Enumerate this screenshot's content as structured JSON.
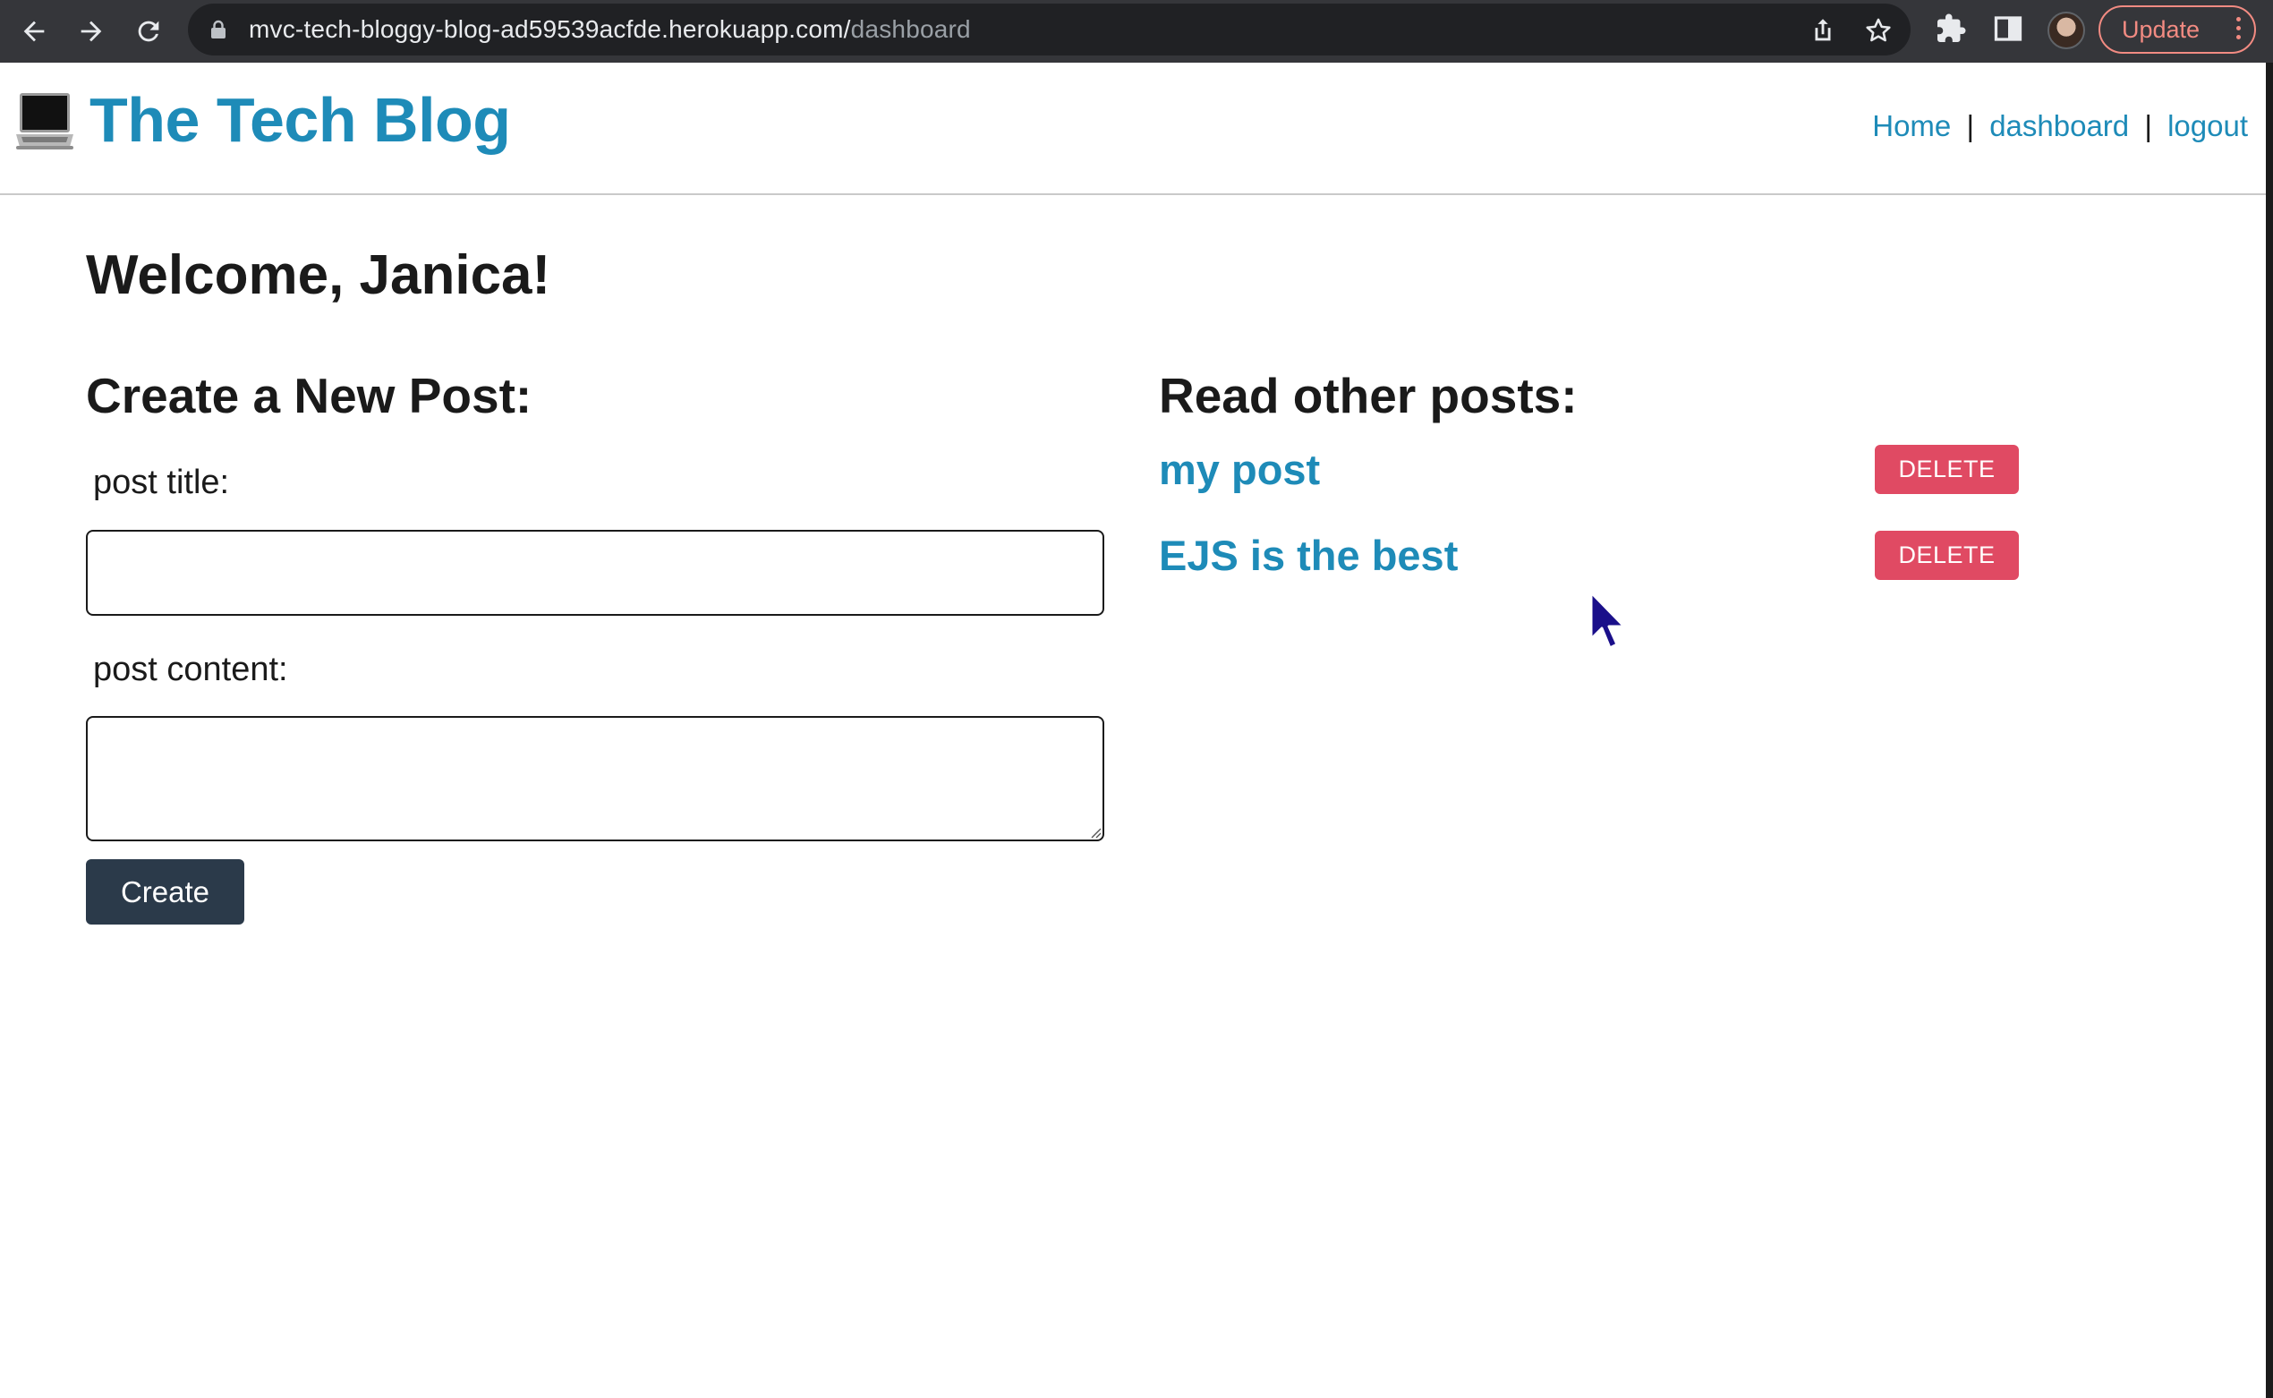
{
  "browser": {
    "url_host": "mvc-tech-bloggy-blog-ad59539acfde.herokuapp.com/",
    "url_path": "dashboard",
    "update_label": "Update",
    "colors": {
      "chrome_bg": "#35363a",
      "omnibox_bg": "#202124",
      "update_accent": "#f28b82"
    },
    "icons": [
      "back-arrow-icon",
      "forward-arrow-icon",
      "reload-icon",
      "lock-icon",
      "share-icon",
      "star-icon",
      "puzzle-icon",
      "side-panel-icon",
      "profile-avatar",
      "more-vert-icon"
    ]
  },
  "site": {
    "title": "The Tech Blog",
    "logo_icon": "laptop-icon",
    "nav": {
      "home": "Home",
      "separator": "|",
      "dashboard": "dashboard",
      "logout": "logout"
    },
    "colors": {
      "brand": "#1e8bb8",
      "text": "#1a1a1a"
    }
  },
  "dashboard": {
    "welcome": "Welcome, Janica!",
    "create_heading": "Create a New Post:",
    "title_label": "post title:",
    "title_value": "",
    "content_label": "post content:",
    "content_value": "",
    "create_button": "Create",
    "posts_heading": "Read other posts:",
    "posts": [
      {
        "title": "my post",
        "delete_label": "DELETE"
      },
      {
        "title": "EJS is the best",
        "delete_label": "DELETE"
      }
    ],
    "colors": {
      "create_button_bg": "#2b3a4a",
      "delete_button_bg": "#e04a63"
    }
  }
}
